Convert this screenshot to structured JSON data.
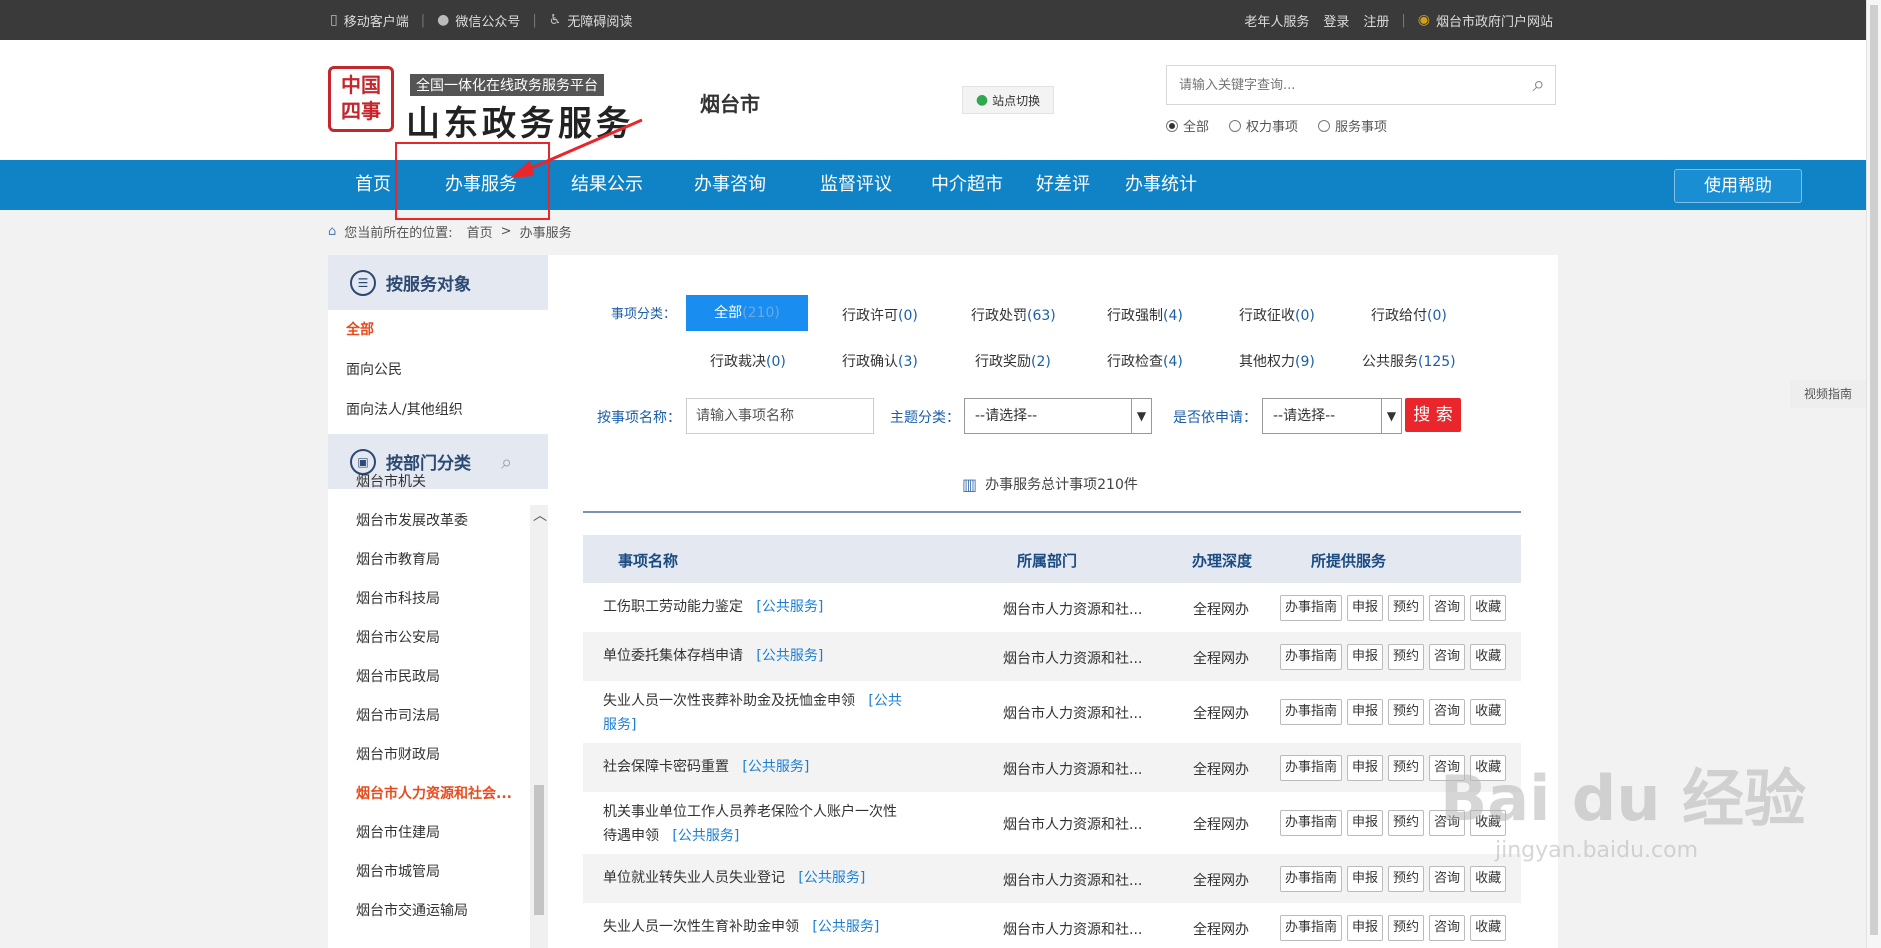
{
  "topbar": {
    "left": [
      {
        "icon": "phone-icon",
        "label": "移动客户端"
      },
      {
        "icon": "wechat-icon",
        "label": "微信公众号"
      },
      {
        "icon": "accessibility-icon",
        "label": "无障碍阅读"
      }
    ],
    "right": [
      "老年人服务",
      "登录",
      "注册"
    ],
    "portal": "烟台市政府门户网站"
  },
  "header": {
    "logo_text": "中国四事",
    "slogan": "全国一体化在线政务服务平台",
    "brand": "山东政务服务",
    "city": "烟台市",
    "site_switch": "站点切换",
    "search_placeholder": "请输入关键字查询...",
    "radios": [
      {
        "label": "全部",
        "checked": true
      },
      {
        "label": "权力事项",
        "checked": false
      },
      {
        "label": "服务事项",
        "checked": false
      }
    ]
  },
  "nav": {
    "items": [
      "首页",
      "办事服务",
      "结果公示",
      "办事咨询",
      "监督评议",
      "中介超市",
      "好差评",
      "办事统计"
    ],
    "help": "使用帮助"
  },
  "breadcrumb": {
    "prefix": "您当前所在的位置:",
    "home": "首页",
    "sep": ">",
    "current": "办事服务"
  },
  "sidebar": {
    "by_target_title": "按服务对象",
    "targets": [
      "全部",
      "面向公民",
      "面向法人/其他组织"
    ],
    "by_dept_title": "按部门分类",
    "depts": [
      "烟台市机关",
      "烟台市发展改革委",
      "烟台市教育局",
      "烟台市科技局",
      "烟台市公安局",
      "烟台市民政局",
      "烟台市司法局",
      "烟台市财政局",
      "烟台市人力资源和社会...",
      "烟台市住建局",
      "烟台市城管局",
      "烟台市交通运输局"
    ]
  },
  "filters": {
    "category_label": "事项分类：",
    "all": {
      "label": "全部",
      "count": "(210)"
    },
    "categories_row1": [
      {
        "label": "行政许可",
        "count": "(0)"
      },
      {
        "label": "行政处罚",
        "count": "(63)"
      },
      {
        "label": "行政强制",
        "count": "(4)"
      },
      {
        "label": "行政征收",
        "count": "(0)"
      },
      {
        "label": "行政给付",
        "count": "(0)"
      }
    ],
    "categories_row2": [
      {
        "label": "行政裁决",
        "count": "(0)"
      },
      {
        "label": "行政确认",
        "count": "(3)"
      },
      {
        "label": "行政奖励",
        "count": "(2)"
      },
      {
        "label": "行政检查",
        "count": "(4)"
      },
      {
        "label": "其他权力",
        "count": "(9)"
      },
      {
        "label": "公共服务",
        "count": "(125)"
      }
    ],
    "name_label": "按事项名称：",
    "name_placeholder": "请输入事项名称",
    "theme_label": "主题分类：",
    "theme_value": "--请选择--",
    "apply_label": "是否依申请：",
    "apply_value": "--请选择--",
    "search_button": "搜 索"
  },
  "total_text": "办事服务总计事项210件",
  "table": {
    "headers": [
      "事项名称",
      "所属部门",
      "办理深度",
      "所提供服务"
    ],
    "buttons": [
      "办事指南",
      "申报",
      "预约",
      "咨询",
      "收藏"
    ],
    "rows": [
      {
        "name": "工伤职工劳动能力鉴定",
        "tag": "[公共服务]",
        "dept": "烟台市人力资源和社...",
        "depth": "全程网办"
      },
      {
        "name": "单位委托集体存档申请",
        "tag": "[公共服务]",
        "dept": "烟台市人力资源和社...",
        "depth": "全程网办"
      },
      {
        "name": "失业人员一次性丧葬补助金及抚恤金申领",
        "tag": "[公共服务]",
        "dept": "烟台市人力资源和社...",
        "depth": "全程网办"
      },
      {
        "name": "社会保障卡密码重置",
        "tag": "[公共服务]",
        "dept": "烟台市人力资源和社...",
        "depth": "全程网办"
      },
      {
        "name": "机关事业单位工作人员养老保险个人账户一次性待遇申领",
        "tag": "[公共服务]",
        "dept": "烟台市人力资源和社...",
        "depth": "全程网办"
      },
      {
        "name": "单位就业转失业人员失业登记",
        "tag": "[公共服务]",
        "dept": "烟台市人力资源和社...",
        "depth": "全程网办"
      },
      {
        "name": "失业人员一次性生育补助金申领",
        "tag": "[公共服务]",
        "dept": "烟台市人力资源和社...",
        "depth": "全程网办"
      }
    ]
  },
  "video_guide": "视频指南",
  "watermark": {
    "main": "Bai du 经验",
    "sub": "jingyan.baidu.com"
  },
  "colors": {
    "nav": "#1082c6",
    "accent_red": "#e8262b",
    "active_orange": "#e84c1e",
    "link_blue": "#1a7fd4"
  }
}
